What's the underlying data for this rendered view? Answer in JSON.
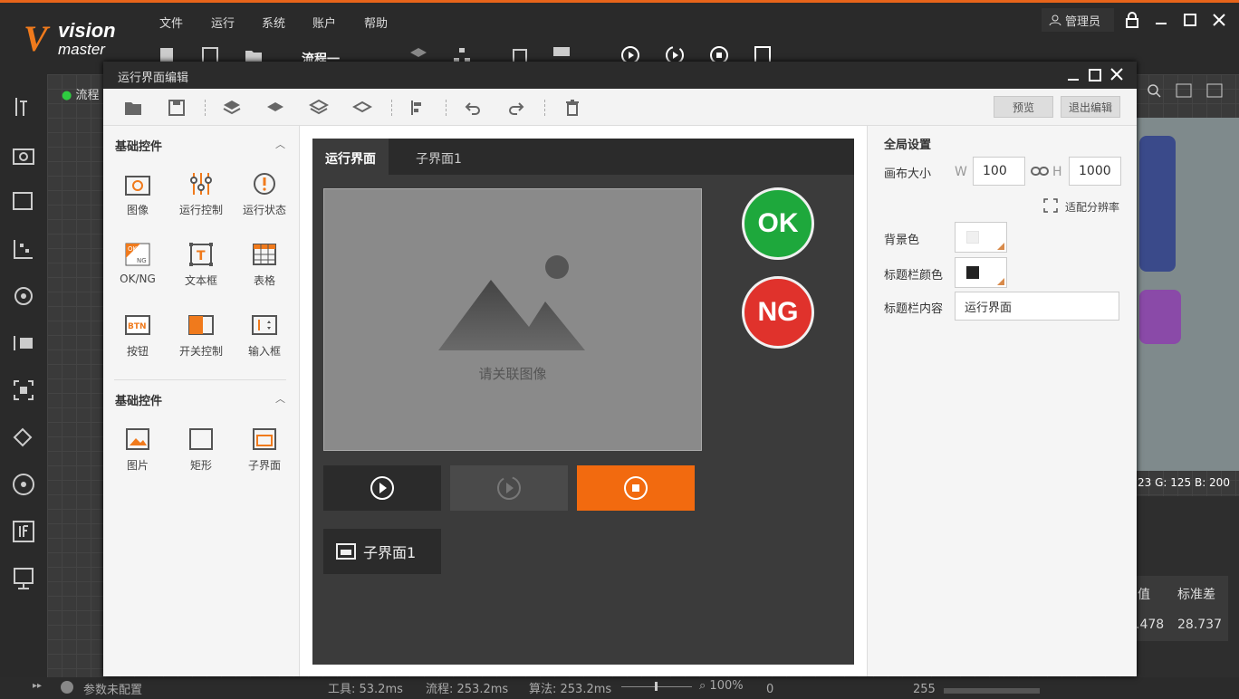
{
  "app": {
    "logo_main": "vision",
    "logo_sub": "master",
    "logo_v": "V"
  },
  "menu": [
    "文件",
    "运行",
    "系统",
    "账户",
    "帮助"
  ],
  "toolbar": {
    "flow_label": "流程一"
  },
  "user": {
    "name": "管理员"
  },
  "left_tab": "流程",
  "dialog": {
    "title": "运行界面编辑",
    "preview": "预览",
    "exit": "退出编辑"
  },
  "palette": {
    "section1": "基础控件",
    "section2": "基础控件",
    "controls1": [
      "图像",
      "运行控制",
      "运行状态",
      "OK/NG",
      "文本框",
      "表格",
      "按钮",
      "开关控制",
      "输入框"
    ],
    "controls2": [
      "图片",
      "矩形",
      "子界面"
    ]
  },
  "stage": {
    "tabs": [
      "运行界面",
      "子界面1"
    ],
    "image_placeholder": "请关联图像",
    "ok": "OK",
    "ng": "NG",
    "subpage_button": "子界面1",
    "icon_btn": "BTN",
    "icon_ok": "OK",
    "icon_ng": "NG",
    "icon_t": "T"
  },
  "props": {
    "title": "全局设置",
    "canvas_size": "画布大小",
    "w_label": "W",
    "w_value": "100",
    "h_label": "H",
    "h_value": "1000",
    "fit_resolution": "适配分辨率",
    "bg_color": "背景色",
    "titlebar_color": "标题栏颜色",
    "titlebar_content": "标题栏内容",
    "titlebar_value": "运行界面"
  },
  "right_panel": {
    "rgb": "23  G: 125  B: 200",
    "col1": "值",
    "col2": "标准差",
    "val1": ".478",
    "val2": "28.737"
  },
  "status": {
    "config": "参数未配置",
    "tool": "工具: 53.2ms",
    "flow": "流程: 253.2ms",
    "algo": "算法: 253.2ms",
    "zoom": "100%",
    "hist_min": "0",
    "hist_max": "255"
  },
  "colors": {
    "accent": "#f07a1c",
    "ok": "#1ea83c",
    "ng": "#e0322c",
    "stop": "#f26a0f"
  }
}
